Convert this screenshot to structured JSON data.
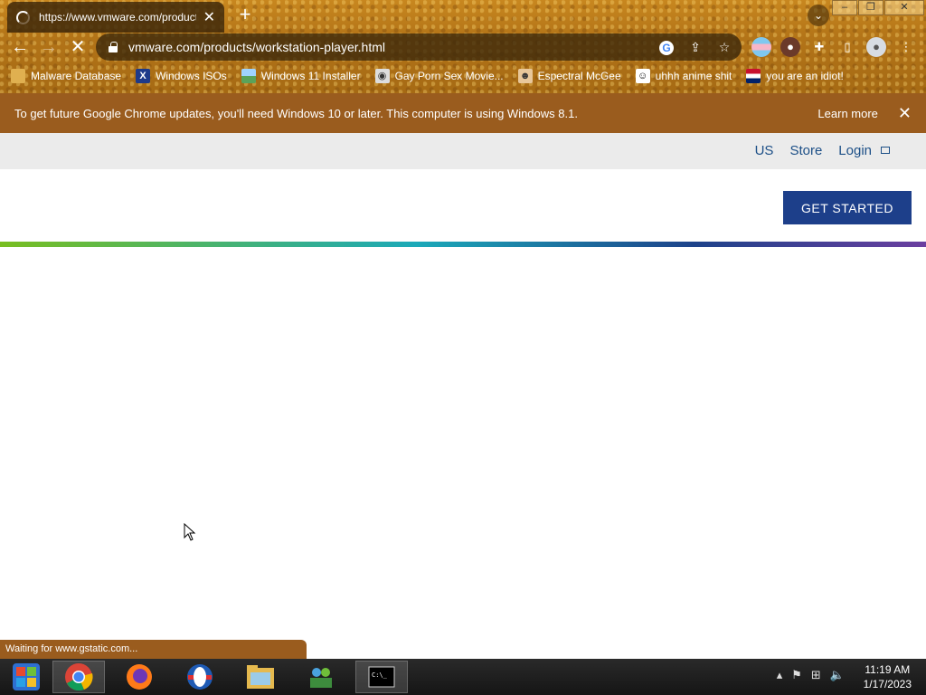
{
  "browser": {
    "tab_title": "https://www.vmware.com/products/workstation-player.html",
    "new_tab_glyph": "+",
    "url": "vmware.com/products/workstation-player.html",
    "bookmarks": [
      {
        "label": "Malware Database",
        "icon": "folder-icon"
      },
      {
        "label": "Windows ISOs",
        "icon": "x-logo-icon"
      },
      {
        "label": "Windows 11 Installer",
        "icon": "image-icon"
      },
      {
        "label": "Gay Porn Sex Movie...",
        "icon": "site-icon"
      },
      {
        "label": "Espectral McGee",
        "icon": "avatar-icon"
      },
      {
        "label": "uhhh anime shit",
        "icon": "anime-icon"
      },
      {
        "label": "you are an idiot!",
        "icon": "flag-icon"
      }
    ],
    "infobar": {
      "message": "To get future Google Chrome updates, you'll need Windows 10 or later. This computer is using Windows 8.1.",
      "learn_more": "Learn more"
    },
    "status": "Waiting for www.gstatic.com..."
  },
  "site": {
    "top_links": {
      "region": "US",
      "store": "Store",
      "login": "Login"
    },
    "cta": "GET STARTED"
  },
  "taskbar": {
    "time": "11:19 AM",
    "date": "1/17/2023"
  },
  "colors": {
    "theme": "#b37418",
    "infobar": "#9a5c1e",
    "cta": "#1d3f8a",
    "link": "#1c4f87"
  }
}
